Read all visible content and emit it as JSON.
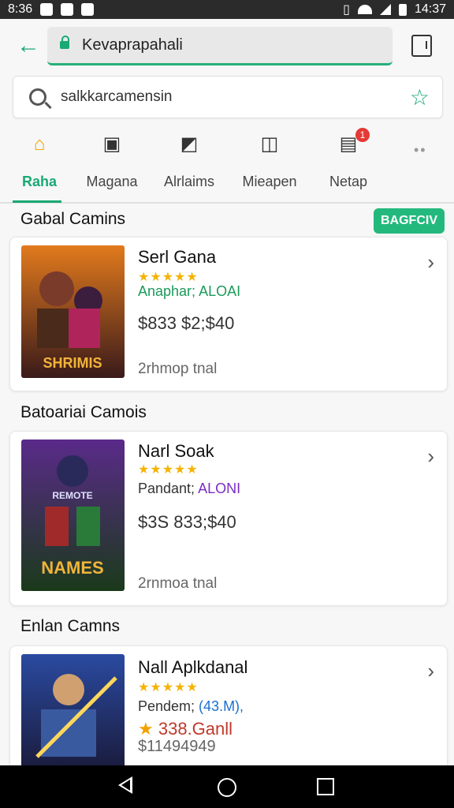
{
  "status_bar": {
    "time_left": "8:36",
    "time_right": "14:37"
  },
  "toolbar": {
    "url": "Kevaprapahali"
  },
  "search": {
    "query": "salkkarcamensin"
  },
  "tabs": [
    {
      "label": "Raha",
      "icon": "home-icon",
      "active": true
    },
    {
      "label": "Magana",
      "icon": "gallery-icon"
    },
    {
      "label": "Alrlaims",
      "icon": "bookmark-icon"
    },
    {
      "label": "Mieapen",
      "icon": "briefcase-icon"
    },
    {
      "label": "Netap",
      "icon": "inbox-icon",
      "badge": "1"
    }
  ],
  "sections": [
    {
      "title": "Gabal Camins",
      "action": "BAGFCIV"
    },
    {
      "title": "Batoariai Camois"
    },
    {
      "title": "Enlan Camns"
    }
  ],
  "cards": [
    {
      "title": "Serl Gana",
      "stars": "★★★★★",
      "meta": "Anaphar; ALOAI",
      "meta_color": "#1c9a5a",
      "price": "$833 $2;$40",
      "size": "2rhmop tnal",
      "art_title": "SHRIMIS"
    },
    {
      "title": "Narl Soak",
      "stars": "★★★★★",
      "meta_a": "Pandant; ",
      "meta_b": "ALONI",
      "price": "$3S 833;$40",
      "size": "2rnmoa tnal",
      "art_title": "NAMES",
      "art_subtitle": "REMOTE"
    },
    {
      "title": "Nall Aplkdanal",
      "stars": "★★★★★",
      "meta_a": "Pendem; ",
      "meta_b": "(43.M),",
      "price_star": "★",
      "price": "338.Ganll",
      "size": "$11494949"
    }
  ],
  "colors": {
    "accent": "#19a974",
    "badge": "#e53935",
    "star": "#f5b400"
  }
}
